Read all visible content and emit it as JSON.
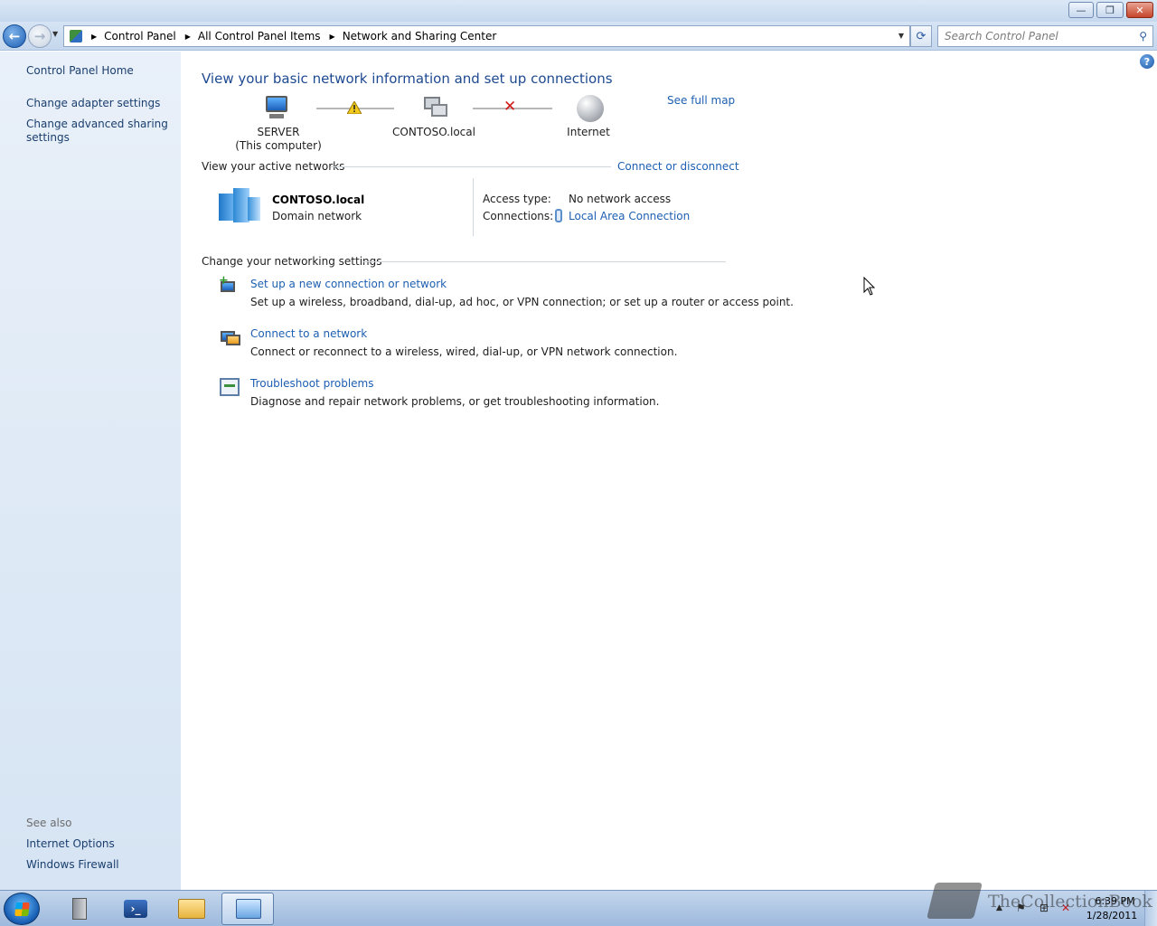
{
  "window": {
    "minimize_glyph": "—",
    "maximize_glyph": "❐",
    "close_glyph": "✕"
  },
  "nav": {
    "back_glyph": "←",
    "forward_glyph": "→",
    "breadcrumbs": [
      "Control Panel",
      "All Control Panel Items",
      "Network and Sharing Center"
    ],
    "search_placeholder": "Search Control Panel"
  },
  "sidebar": {
    "home": "Control Panel Home",
    "adapter": "Change adapter settings",
    "advanced": "Change advanced sharing settings",
    "see_also": "See also",
    "internet_options": "Internet Options",
    "firewall": "Windows Firewall"
  },
  "main": {
    "title": "View your basic network information and set up connections",
    "full_map": "See full map",
    "map": {
      "server_line1": "SERVER",
      "server_line2": "(This computer)",
      "contoso": "CONTOSO.local",
      "internet": "Internet"
    },
    "active_networks_label": "View your active networks",
    "connect_disconnect": "Connect or disconnect",
    "network": {
      "name": "CONTOSO.local",
      "type": "Domain network",
      "access_type_label": "Access type:",
      "access_type_value": "No network access",
      "connections_label": "Connections:",
      "connections_value": "Local Area Connection"
    },
    "change_settings_label": "Change your networking settings",
    "tasks": [
      {
        "title": "Set up a new connection or network",
        "desc": "Set up a wireless, broadband, dial-up, ad hoc, or VPN connection; or set up a router or access point."
      },
      {
        "title": "Connect to a network",
        "desc": "Connect or reconnect to a wireless, wired, dial-up, or VPN network connection."
      },
      {
        "title": "Troubleshoot problems",
        "desc": "Diagnose and repair network problems, or get troubleshooting information."
      }
    ]
  },
  "taskbar": {
    "clock_time": "6:39 PM",
    "clock_date": "1/28/2011",
    "ps_glyph": "›_"
  },
  "watermark": {
    "text": "TheCollectionBook"
  },
  "icons": {
    "help": "?",
    "search": "⚲",
    "refresh": "⟳",
    "dropdown": "▼",
    "crumb_arrow": "▶",
    "error": "✕",
    "tray_up": "▲",
    "flag": "⚑",
    "network": "⊞",
    "volume": "✕"
  }
}
